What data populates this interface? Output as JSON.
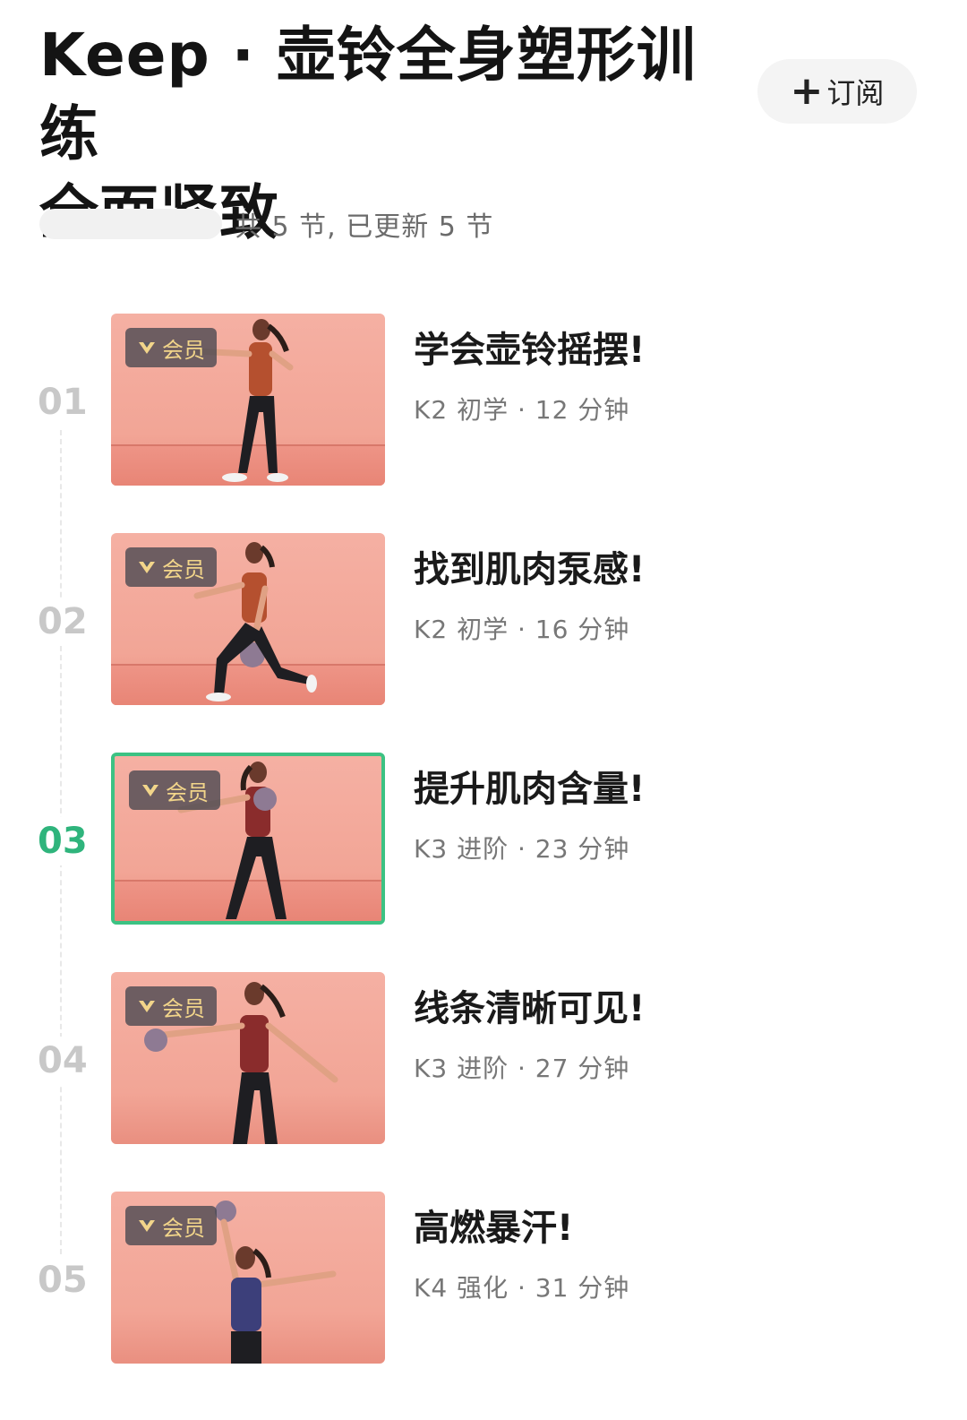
{
  "header": {
    "title_line1": "Keep · 壶铃全身塑形训练",
    "title_line2": "全面紧致",
    "subscribe_label": "订阅"
  },
  "summary": "共 5 节, 已更新 5 节",
  "badge_label": "会员",
  "colors": {
    "accent": "#2fb47c",
    "badge_text": "#f2d58a",
    "thumb_bg": "#f2a596"
  },
  "lessons": [
    {
      "index": "01",
      "title": "学会壶铃摇摆!",
      "meta": "K2 初学 · 12 分钟",
      "active": false
    },
    {
      "index": "02",
      "title": "找到肌肉泵感!",
      "meta": "K2 初学 · 16 分钟",
      "active": false
    },
    {
      "index": "03",
      "title": "提升肌肉含量!",
      "meta": "K3 进阶 · 23 分钟",
      "active": true
    },
    {
      "index": "04",
      "title": "线条清晰可见!",
      "meta": "K3 进阶 · 27 分钟",
      "active": false
    },
    {
      "index": "05",
      "title": "高燃暴汗!",
      "meta": "K4 强化 · 31 分钟",
      "active": false
    }
  ]
}
